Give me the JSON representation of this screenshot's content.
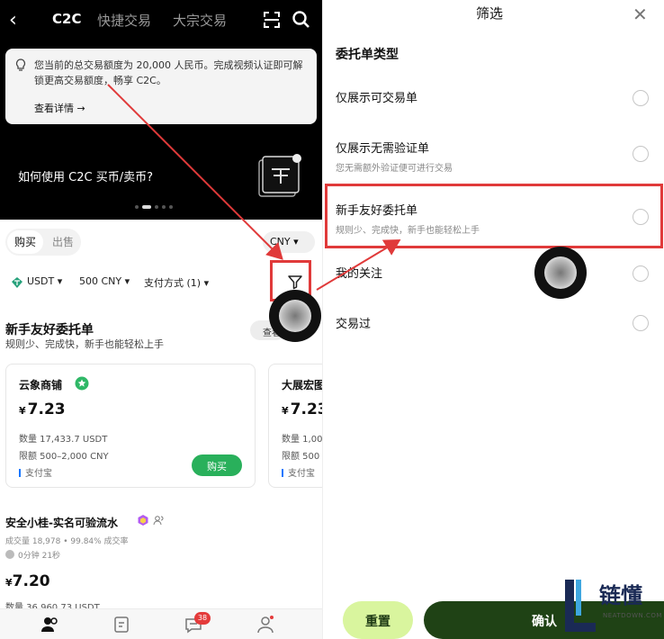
{
  "left": {
    "nav": {
      "tabs": [
        "C2C",
        "快捷交易",
        "大宗交易"
      ]
    },
    "notice": {
      "message": "您当前的总交易额度为 20,000 人民币。完成视频认证即可解锁更高交易额度，畅享 C2C。",
      "link": "查看详情 →"
    },
    "banner": {
      "title": "如何使用 C2C 买币/卖币?"
    },
    "trade_tabs": [
      "购买",
      "出售"
    ],
    "currency": "CNY ▾",
    "filters": {
      "coin": "USDT ▾",
      "amount": "500 CNY ▾",
      "payment": "支付方式 (1) ▾"
    },
    "section": {
      "title": "新手友好委托单",
      "subtitle": "规则少、完成快，新手也能轻松上手",
      "view_label": "查看"
    },
    "cards": [
      {
        "merchant": "云象商铺",
        "currency_symbol": "¥",
        "price": "7.23",
        "qty": "数量  17,433.7 USDT",
        "limit": "限额  500–2,000 CNY",
        "pay": "支付宝",
        "buy_label": "购买"
      },
      {
        "merchant": "大展宏图",
        "currency_symbol": "¥",
        "price": "7.23",
        "qty": "数量  1,00",
        "limit": "限额  500",
        "pay": "支付宝"
      }
    ],
    "listing": {
      "name": "安全小桂-实名可验流水",
      "stats": "成交量 18,978  •  99.84% 成交率",
      "time": "0分钟 21秒",
      "currency_symbol": "¥",
      "price": "7.20",
      "qty": "数量  36,960.73 USDT"
    },
    "bottom_nav": {
      "badge": "38"
    }
  },
  "right": {
    "title": "筛选",
    "section": "委托单类型",
    "options": [
      {
        "label": "仅展示可交易单",
        "desc": ""
      },
      {
        "label": "仅展示无需验证单",
        "desc": "您无需额外验证便可进行交易"
      },
      {
        "label": "新手友好委托单",
        "desc": "规则少、完成快，新手也能轻松上手"
      },
      {
        "label": "我的关注",
        "desc": ""
      },
      {
        "label": "交易过",
        "desc": ""
      }
    ],
    "reset": "重置",
    "confirm": "确认"
  },
  "logo": {
    "cn": "链懂",
    "en": "NEATDOWN.COM"
  },
  "colors": {
    "accent_green": "#29b05b",
    "dark_green": "#1f4215",
    "lime": "#d9f59e",
    "highlight_red": "#e03a3a"
  }
}
